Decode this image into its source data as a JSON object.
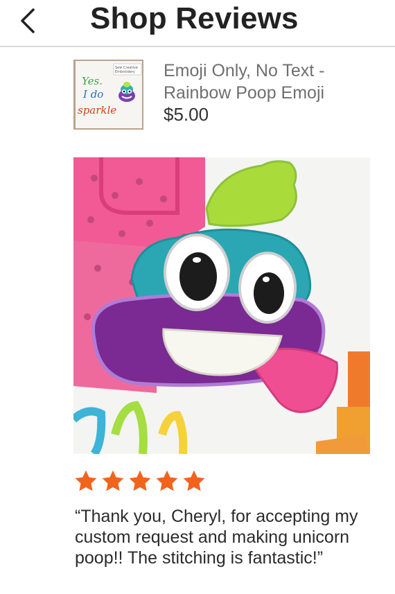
{
  "header": {
    "title": "Shop Reviews",
    "back_icon": "chevron-left-icon"
  },
  "listing": {
    "title": "Emoji Only, No Text - Rainbow Poop Emoji",
    "price": "$5.00",
    "thumbnail_text": {
      "corner_label": "Sew Creative Embroidery",
      "line1": "Yes.",
      "line2": "I do",
      "line3": "sparkle"
    }
  },
  "review": {
    "rating": 5,
    "max_rating": 5,
    "star_color": "#f1641e",
    "text": "“Thank you, Cheryl, for accepting my custom request and making unicorn poop!!  The stitching is fantastic!”"
  }
}
